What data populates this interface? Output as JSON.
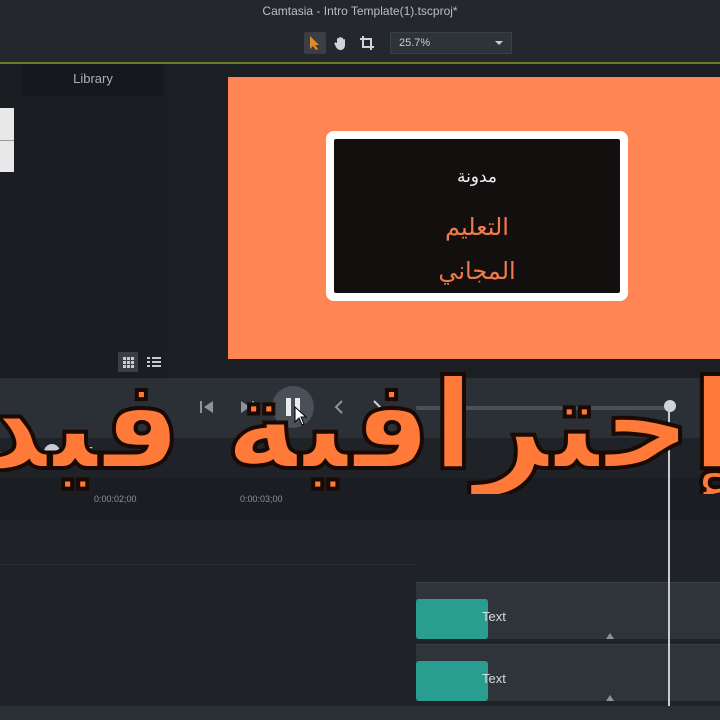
{
  "window": {
    "title": "Camtasia - Intro Template(1).tscproj*"
  },
  "toolbar": {
    "tools": [
      {
        "icon": "arrow-cursor-icon",
        "active": true
      },
      {
        "icon": "hand-pan-icon",
        "active": false
      },
      {
        "icon": "crop-icon",
        "active": false
      }
    ],
    "zoom": {
      "value": "25.7%"
    }
  },
  "left_panel": {
    "tab_label": "Library"
  },
  "canvas": {
    "slide_color": "#ff8554",
    "text_box": {
      "word": "مدونة",
      "line1": "التعليم",
      "line2": "المجاني"
    }
  },
  "playback": {
    "buttons": [
      "step-back-icon",
      "step-forward-icon",
      "pause-icon",
      "previous-icon",
      "next-icon"
    ]
  },
  "ruler": {
    "ticks": [
      "0:00:02;00",
      "0:00:03;00"
    ]
  },
  "tracks": [
    {
      "clip_label": "Text"
    },
    {
      "clip_label": "Text"
    }
  ],
  "overlay": {
    "text": "إحترافية فيديو"
  },
  "colors": {
    "accent": "#ff7a38",
    "clip": "#2a9d91",
    "toolbar_line": "#6e7a28"
  }
}
